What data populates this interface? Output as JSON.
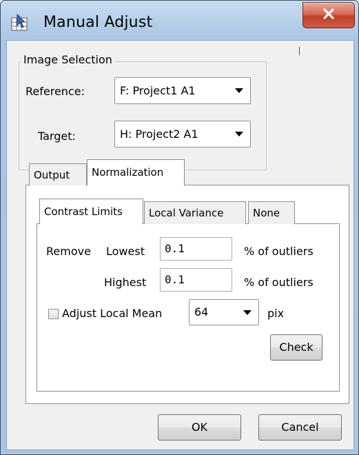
{
  "window": {
    "title": "Manual Adjust",
    "close_icon": "close-icon",
    "app_icon": "grid-cursor-icon"
  },
  "image_selection": {
    "legend": "Image Selection",
    "reference_label": "Reference:",
    "reference_value": "F: Project1 A1",
    "target_label": "Target:",
    "target_value": "H: Project2 A1"
  },
  "main_tabs": [
    {
      "label": "Output",
      "selected": false
    },
    {
      "label": "Normalization",
      "selected": true
    }
  ],
  "sub_tabs": [
    {
      "label": "Contrast Limits",
      "selected": true
    },
    {
      "label": "Local Variance",
      "selected": false
    },
    {
      "label": "None",
      "selected": false
    }
  ],
  "contrast": {
    "remove_label": "Remove",
    "lowest_label": "Lowest",
    "lowest_value": "0.1",
    "lowest_unit": "% of outliers",
    "highest_label": "Highest",
    "highest_value": "0.1",
    "highest_unit": "% of outliers",
    "adjust_local_mean_label": "Adjust Local Mean",
    "adjust_local_mean_checked": false,
    "local_mean_value": "64",
    "local_mean_unit": "pix",
    "check_label": "Check"
  },
  "footer": {
    "ok_label": "OK",
    "cancel_label": "Cancel"
  }
}
